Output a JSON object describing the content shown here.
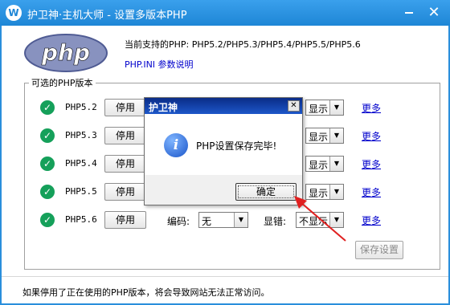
{
  "window": {
    "title": "护卫神·主机大师 - 设置多版本PHP",
    "icon_letter": "W"
  },
  "header": {
    "logo_text": "php",
    "supported_text": "当前支持的PHP: PHP5.2/PHP5.3/PHP5.4/PHP5.5/PHP5.6",
    "ini_link": "PHP.INI 参数说明"
  },
  "group_label": "可选的PHP版本",
  "rows": [
    {
      "version": "PHP5.2",
      "stop": "停用",
      "errors_value": "显示",
      "more": "更多"
    },
    {
      "version": "PHP5.3",
      "stop": "停用",
      "errors_value": "显示",
      "more": "更多"
    },
    {
      "version": "PHP5.4",
      "stop": "停用",
      "errors_value": "显示",
      "more": "更多"
    },
    {
      "version": "PHP5.5",
      "stop": "停用",
      "errors_value": "显示",
      "more": "更多"
    },
    {
      "version": "PHP5.6",
      "stop": "停用",
      "encoding_label": "编码:",
      "encoding_value": "无",
      "errors_label": "显错:",
      "errors_value": "不显示",
      "more": "更多"
    }
  ],
  "save_button": "保存设置",
  "footer_text": "如果停用了正在使用的PHP版本，将会导致网站无法正常访问。",
  "dialog": {
    "title": "护卫神",
    "message": "PHP设置保存完毕!",
    "ok": "确定",
    "close": "✕"
  },
  "icons": {
    "check": "check-circle-icon",
    "info": "info-icon",
    "annotation": "red-arrow"
  },
  "colors": {
    "title_bar": "#1e86d6",
    "check": "#15a05a",
    "link": "#0000cc",
    "dialog_title": "#0a2c87",
    "arrow": "#e02020"
  }
}
